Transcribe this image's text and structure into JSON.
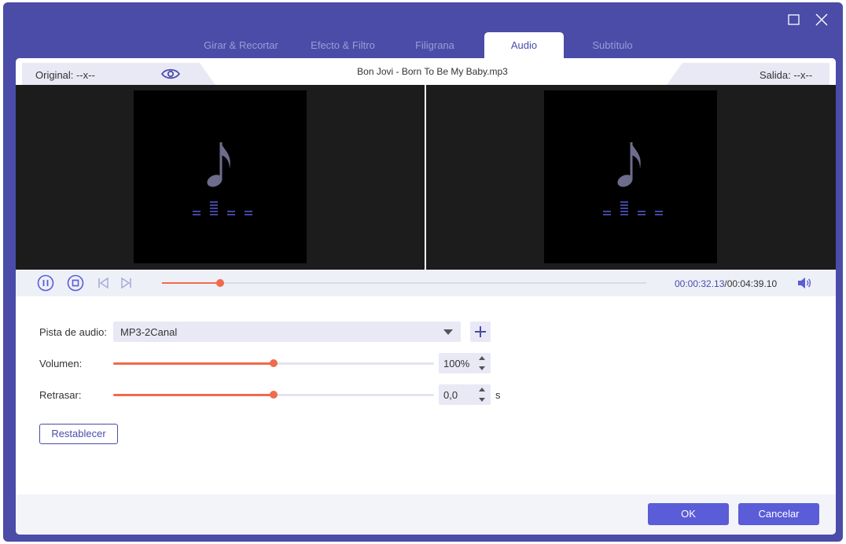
{
  "tabs": [
    {
      "label": "Girar & Recortar",
      "active": false
    },
    {
      "label": "Efecto & Filtro",
      "active": false
    },
    {
      "label": "Filigrana",
      "active": false
    },
    {
      "label": "Audio",
      "active": true
    },
    {
      "label": "Subtítulo",
      "active": false
    }
  ],
  "preview": {
    "original_label": "Original: --x--",
    "output_label": "Salida: --x--",
    "file_name": "Bon Jovi - Born To Be My Baby.mp3"
  },
  "player": {
    "current_time": "00:00:32.13",
    "separator": "/",
    "total_time": "00:04:39.10",
    "progress": 0.12
  },
  "settings": {
    "audio_track_label": "Pista de audio:",
    "audio_track_value": "MP3-2Canal",
    "volume_label": "Volumen:",
    "volume_value": "100%",
    "volume_level": 0.5,
    "delay_label": "Retrasar:",
    "delay_value": "0,0",
    "delay_level": 0.5,
    "delay_unit": "s",
    "reset_label": "Restablecer"
  },
  "footer": {
    "ok_label": "OK",
    "cancel_label": "Cancelar"
  },
  "colors": {
    "accent": "#4a4ca8",
    "button": "#5a5cd8",
    "slider": "#f06a4c",
    "note": "#6e6c8c"
  },
  "icons": [
    "maximize-icon",
    "close-icon",
    "eye-icon",
    "music-note-icon",
    "pause-icon",
    "stop-icon",
    "previous-icon",
    "next-icon",
    "volume-icon",
    "plus-icon",
    "dropdown-icon",
    "spin-up-icon",
    "spin-down-icon"
  ]
}
